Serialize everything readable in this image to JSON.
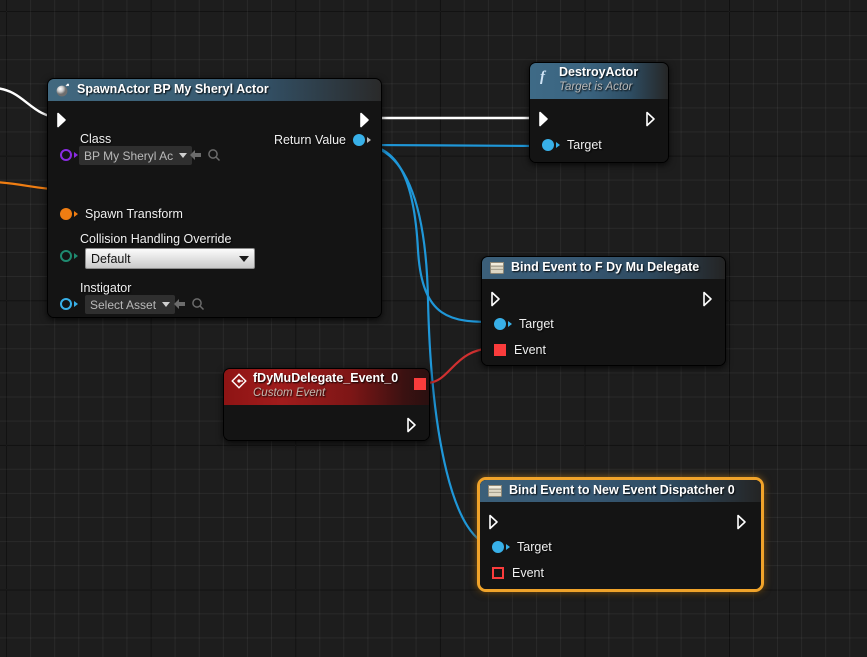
{
  "editor": {
    "app": "blueprint-graph-editor",
    "canvas_bg": "#1d1d1d",
    "grid_line": "#2b2b2b",
    "grid_major": "#0c0c0c"
  },
  "colors": {
    "exec_white": "#ffffff",
    "object_blue": "#38b0e8",
    "class_purple": "#8a2be2",
    "transform_orange": "#ef7d12",
    "delegate_red": "#fa3c3c",
    "enum_teal": "#1f8a70",
    "selection_orange": "#f0a32a"
  },
  "nodes": [
    {
      "id": "spawn-actor",
      "title": "SpawnActor BP My Sheryl Actor",
      "subtitle": "",
      "icon": "spawn-actor-icon",
      "selected": false,
      "exec_in": {
        "label": "",
        "connected": true
      },
      "exec_out": {
        "label": "",
        "connected": true
      },
      "output_pins": [
        {
          "name": "Return Value",
          "type": "object",
          "color": "#38b0e8",
          "connected": true
        }
      ],
      "input_pins": [
        {
          "name": "Class",
          "type": "class",
          "color": "#8a2be2",
          "connected": false
        },
        {
          "name": "Spawn Transform",
          "type": "struct",
          "color": "#ef7d12",
          "connected": true
        },
        {
          "name": "Collision Handling Override",
          "type": "enum",
          "color": "#1f8a70",
          "connected": false
        },
        {
          "name": "Instigator",
          "type": "object",
          "color": "#38b0e8",
          "connected": false
        }
      ],
      "widgets": {
        "class_value": "BP My Sheryl Ac",
        "collision_value": "Default",
        "instigator_value": "Select Asset"
      },
      "has_expander": true
    },
    {
      "id": "destroy-actor",
      "title": "DestroyActor",
      "subtitle": "Target is Actor",
      "icon": "function-f-icon",
      "selected": false,
      "exec_in": {
        "label": "",
        "connected": true
      },
      "exec_out": {
        "label": "",
        "connected": false
      },
      "input_pins": [
        {
          "name": "Target",
          "type": "object",
          "color": "#38b0e8",
          "connected": true
        }
      ],
      "output_pins": []
    },
    {
      "id": "bind-event-fdymu",
      "title": "Bind Event to F Dy Mu Delegate",
      "subtitle": "",
      "icon": "delegate-icon",
      "selected": false,
      "exec_in": {
        "label": "",
        "connected": false
      },
      "exec_out": {
        "label": "",
        "connected": false
      },
      "input_pins": [
        {
          "name": "Target",
          "type": "object",
          "color": "#38b0e8",
          "connected": true
        },
        {
          "name": "Event",
          "type": "delegate",
          "color": "#fa3c3c",
          "connected": true
        }
      ],
      "output_pins": []
    },
    {
      "id": "custom-event",
      "title": "fDyMuDelegate_Event_0",
      "subtitle": "Custom Event",
      "icon": "custom-event-icon",
      "selected": false,
      "exec_out": {
        "label": "",
        "connected": false
      },
      "output_pins": [
        {
          "name": "",
          "type": "delegate",
          "color": "#fa3c3c",
          "connected": true
        }
      ],
      "input_pins": []
    },
    {
      "id": "bind-event-dispatcher",
      "title": "Bind Event to New Event Dispatcher 0",
      "subtitle": "",
      "icon": "delegate-icon",
      "selected": true,
      "exec_in": {
        "label": "",
        "connected": false
      },
      "exec_out": {
        "label": "",
        "connected": false
      },
      "input_pins": [
        {
          "name": "Target",
          "type": "object",
          "color": "#38b0e8",
          "connected": true
        },
        {
          "name": "Event",
          "type": "delegate",
          "color": "#fa3c3c",
          "connected": false
        }
      ],
      "output_pins": []
    }
  ],
  "wires": [
    {
      "from": "offscreen-left",
      "to": "spawn-actor.exec-in",
      "color": "#ffffff",
      "type": "exec"
    },
    {
      "from": "offscreen-left",
      "to": "spawn-actor.spawn-transform",
      "color": "#ef7d12",
      "type": "data"
    },
    {
      "from": "spawn-actor.exec-out",
      "to": "destroy-actor.exec-in",
      "color": "#ffffff",
      "type": "exec"
    },
    {
      "from": "spawn-actor.return-value",
      "to": "destroy-actor.target",
      "color": "#38b0e8",
      "type": "data"
    },
    {
      "from": "spawn-actor.return-value",
      "to": "bind-event-fdymu.target",
      "color": "#38b0e8",
      "type": "data"
    },
    {
      "from": "spawn-actor.return-value",
      "to": "bind-event-dispatcher.target",
      "color": "#38b0e8",
      "type": "data"
    },
    {
      "from": "custom-event.delegate-out",
      "to": "bind-event-fdymu.event",
      "color": "#e03232",
      "type": "delegate"
    }
  ]
}
